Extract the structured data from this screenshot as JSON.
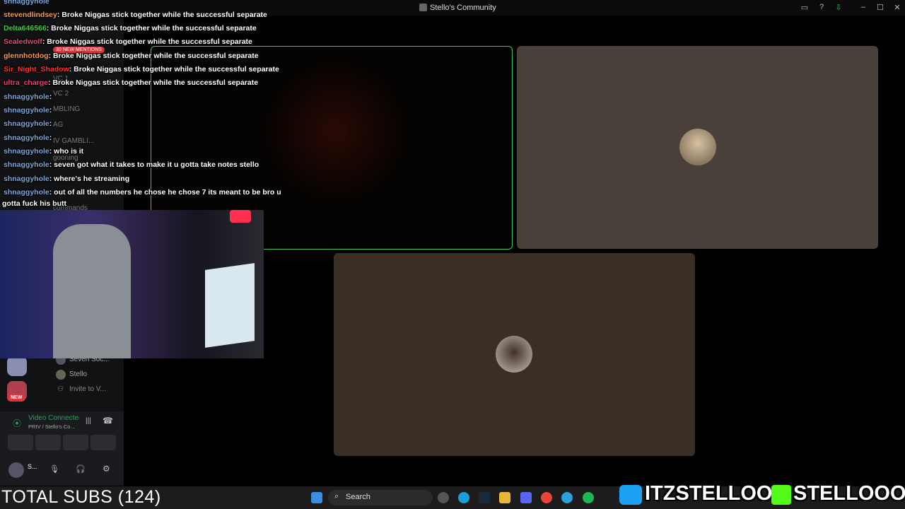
{
  "window": {
    "title": "Stello's Community"
  },
  "colors": {
    "speaking_border": "#3cc46a",
    "online": "#23a559",
    "badge_new": "#da373c"
  },
  "chat": [
    {
      "user": "shnaggyhole",
      "color": "#7ea7d8",
      "text": ""
    },
    {
      "user": "stevendlindsey",
      "color": "#ff9a3c",
      "text": ": Broke Niggas stick together while the successful separate"
    },
    {
      "user": "Delta646566",
      "color": "#40d040",
      "text": ": Broke Niggas stick together while the successful separate"
    },
    {
      "user": "Sealedwolf",
      "color": "#e04b7a",
      "text": ": Broke Niggas stick together while the successful separate"
    },
    {
      "user": "glennhotdog",
      "color": "#ff9a3c",
      "text": ": Broke Niggas stick together while the successful separate"
    },
    {
      "user": "Sir_Night_Shadow",
      "color": "#ff3030",
      "text": ": Broke Niggas stick together while the successful separate"
    },
    {
      "user": "ultra_charge",
      "color": "#ff3a6a",
      "text": ": Broke Niggas stick together while the successful separate"
    },
    {
      "user": "shnaggyhole",
      "color": "#7ea7d8",
      "text": ":"
    },
    {
      "user": "shnaggyhole",
      "color": "#7ea7d8",
      "text": ":"
    },
    {
      "user": "shnaggyhole",
      "color": "#7ea7d8",
      "text": ":"
    },
    {
      "user": "shnaggyhole",
      "color": "#7ea7d8",
      "text": ":"
    },
    {
      "user": "shnaggyhole",
      "color": "#7ea7d8",
      "text": ": who is it"
    },
    {
      "user": "shnaggyhole",
      "color": "#7ea7d8",
      "text": ": seven got what it takes to make it u gotta take notes stello"
    },
    {
      "user": "shnaggyhole",
      "color": "#7ea7d8",
      "text": ": where's he streaming"
    },
    {
      "user": "shnaggyhole",
      "color": "#7ea7d8",
      "text": ": out of all the numbers he chose he chose 7 its meant to be bro u"
    }
  ],
  "chat_wrap": "gotta fuck his butt",
  "sidebar": {
    "mentions_badge": "30 NEW MENTIONS",
    "channels": [
      "VC 1",
      "VC 2",
      "MBLING",
      "AG",
      "IV GAMBLI...",
      "gooning",
      "commands"
    ],
    "voice_members": [
      "Seven Soc...",
      "Stello"
    ],
    "invite": "Invite to V...",
    "new_badge": "NEW"
  },
  "voice": {
    "status": "Video Connected",
    "channel": "PRIV / Stello's Co...",
    "user_short": "S..."
  },
  "overlay": {
    "total_subs": "TOTAL SUBS (124)"
  },
  "taskbar": {
    "search_placeholder": "Search"
  },
  "socials": {
    "twitter": "ITZSTELLOO",
    "kick": "STELLOOO"
  }
}
